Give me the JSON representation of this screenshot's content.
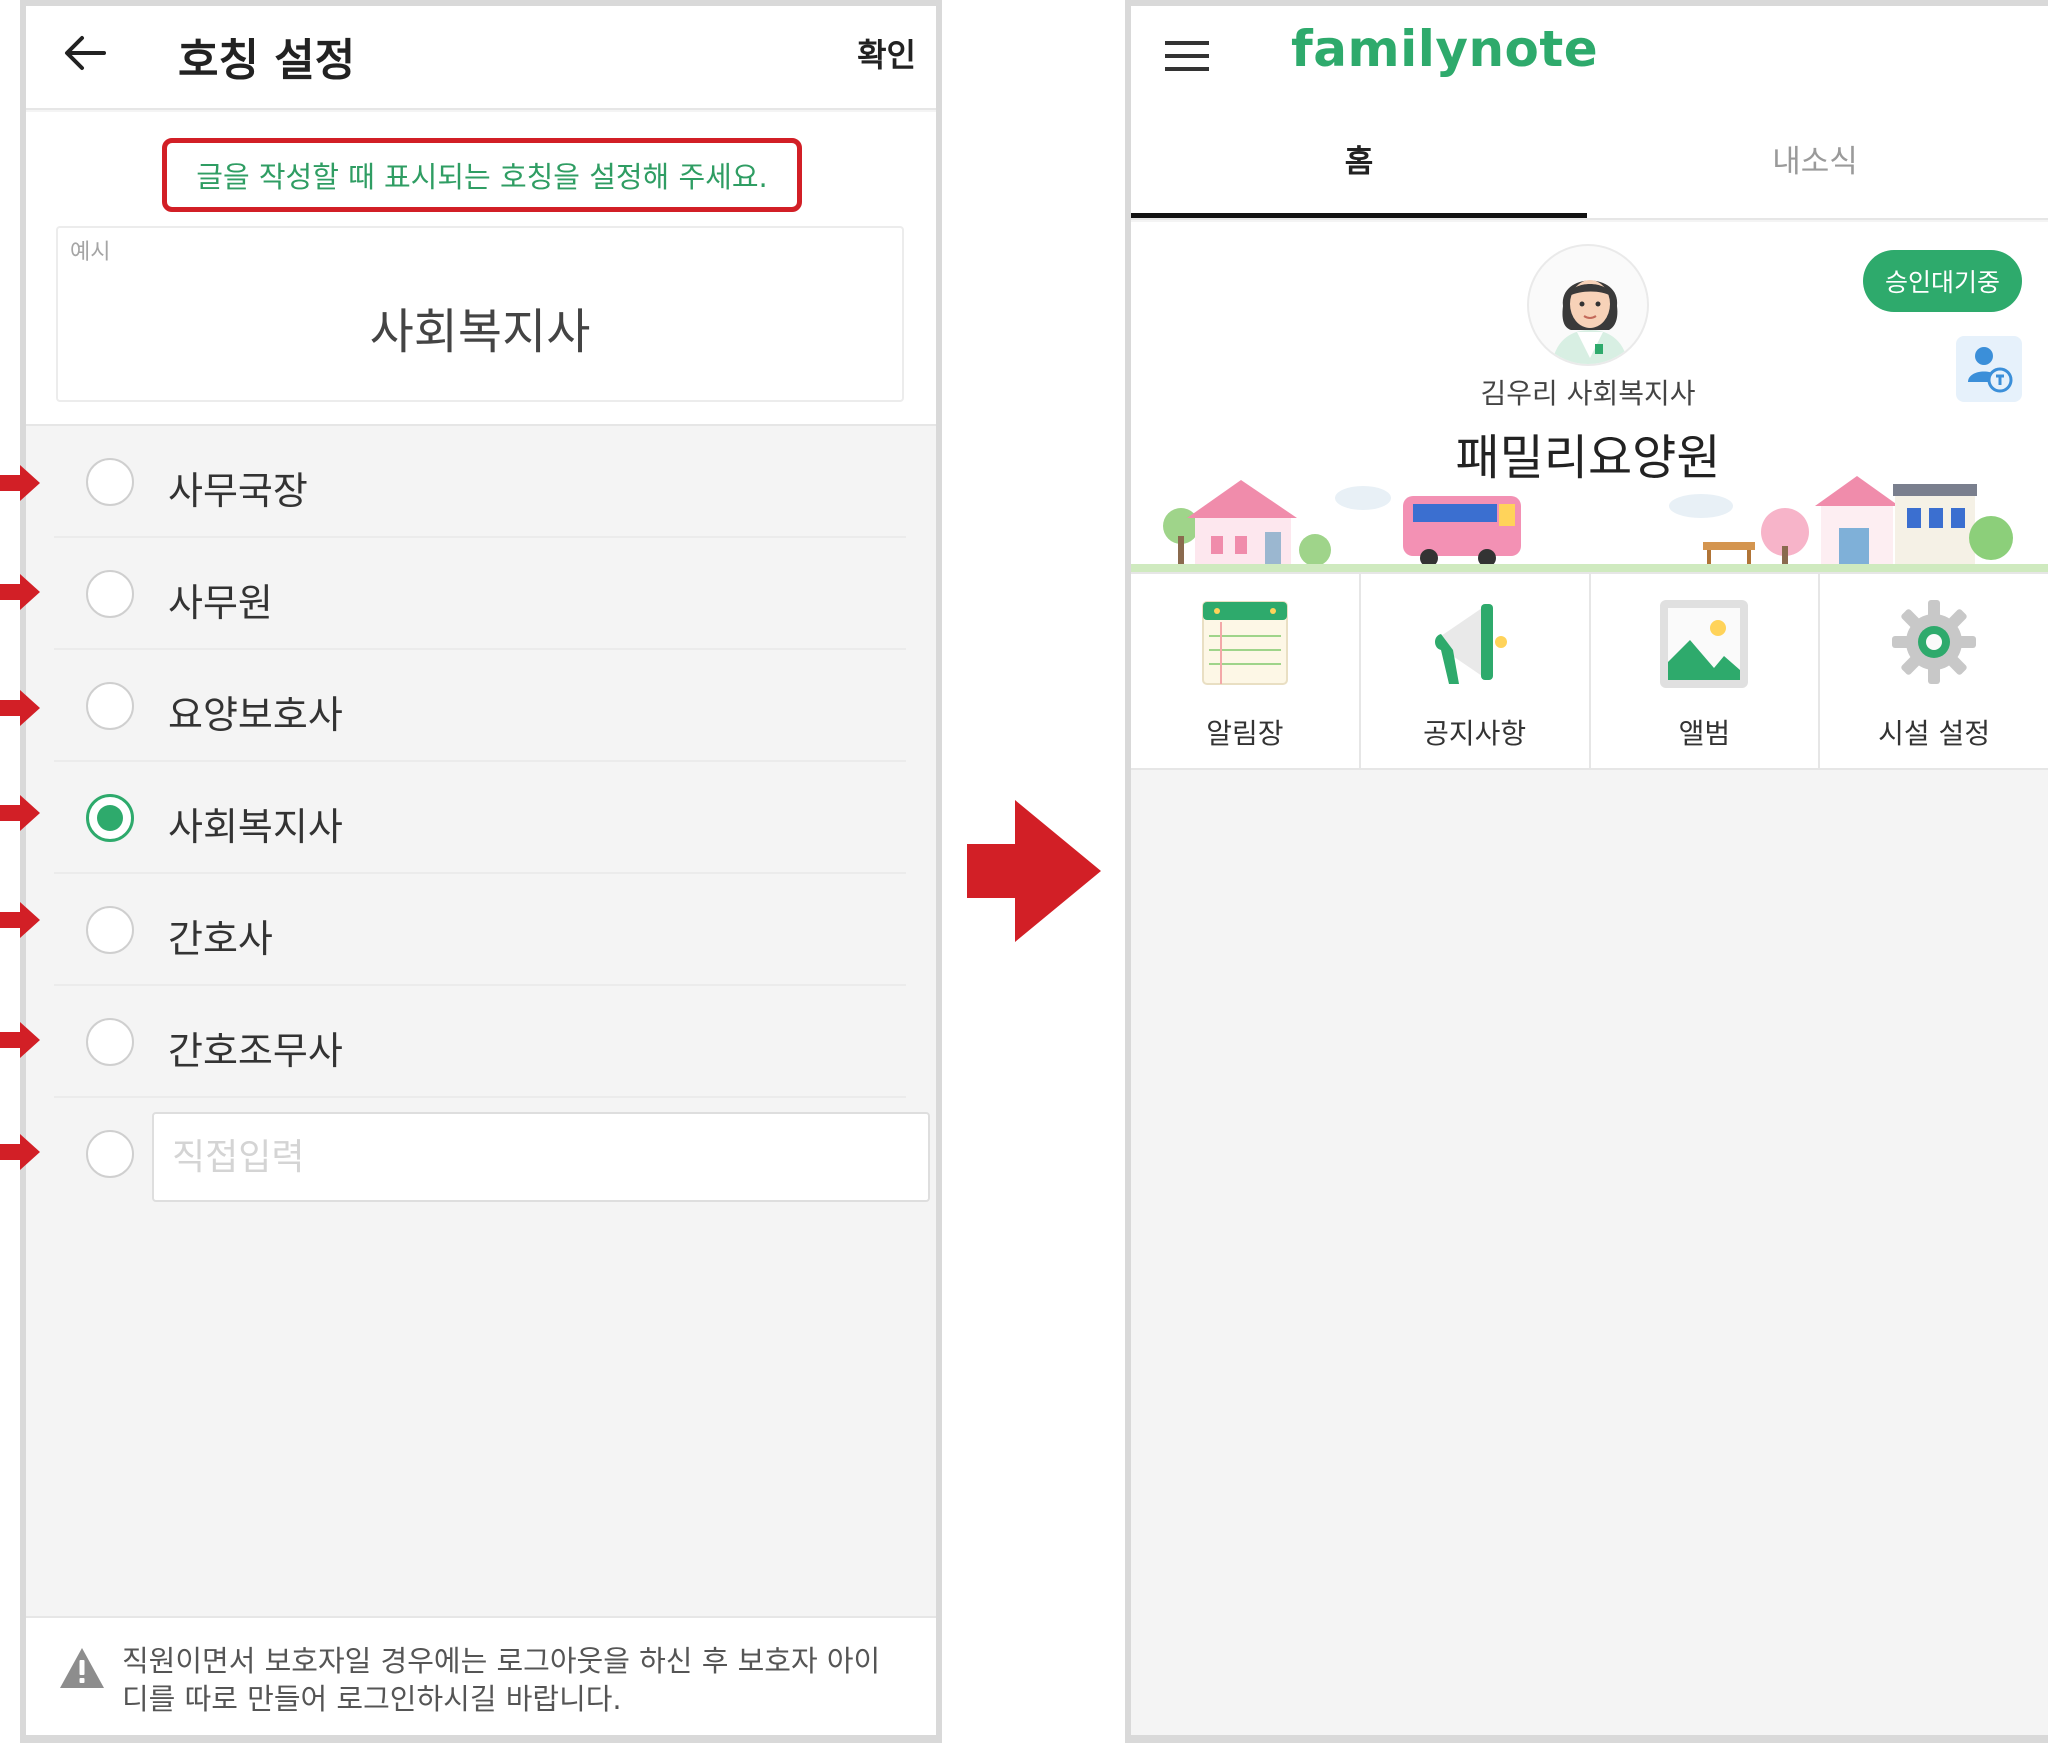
{
  "settings_screen": {
    "title": "호칭 설정",
    "confirm_label": "확인",
    "instruction": "글을 작성할 때 표시되는 호칭을 설정해 주세요.",
    "example_label": "예시",
    "example_value": "사회복지사",
    "options": [
      {
        "label": "사무국장",
        "selected": false
      },
      {
        "label": "사무원",
        "selected": false
      },
      {
        "label": "요양보호사",
        "selected": false
      },
      {
        "label": "사회복지사",
        "selected": true
      },
      {
        "label": "간호사",
        "selected": false
      },
      {
        "label": "간호조무사",
        "selected": false
      }
    ],
    "custom_input_placeholder": "직접입력",
    "custom_input_value": "",
    "notice": "직원이면서 보호자일 경우에는 로그아웃을 하신 후 보호자 아이디를 따로 만들어 로그인하시길 바랍니다.",
    "icons": {
      "back": "arrow-left-icon",
      "warning": "warning-triangle-icon"
    }
  },
  "home_screen": {
    "brand": "familynote",
    "tabs": [
      {
        "label": "홈",
        "active": true
      },
      {
        "label": "내소식",
        "active": false
      }
    ],
    "status_badge": "승인대기중",
    "user_name": "김우리 사회복지사",
    "facility_name": "패밀리요양원",
    "menu": [
      {
        "label": "알림장",
        "icon": "notebook-icon"
      },
      {
        "label": "공지사항",
        "icon": "megaphone-icon"
      },
      {
        "label": "앨범",
        "icon": "photo-album-icon"
      },
      {
        "label": "시설 설정",
        "icon": "gear-icon"
      }
    ],
    "icons": {
      "menu": "hamburger-menu-icon",
      "switch_account": "switch-account-icon"
    }
  },
  "colors": {
    "accent_green": "#2eaa6c",
    "annotation_red": "#d21f26",
    "background_gray": "#f4f4f4"
  }
}
